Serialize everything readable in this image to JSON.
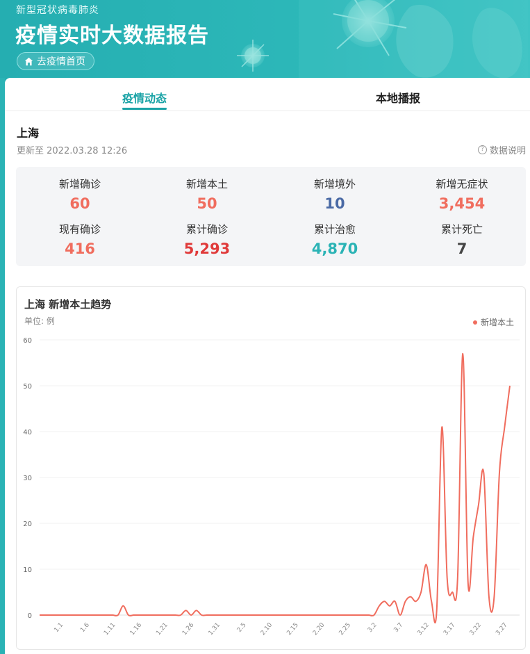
{
  "header": {
    "sub_title": "新型冠状病毒肺炎",
    "title": "疫情实时大数据报告",
    "home_button": "去疫情首页"
  },
  "tabs": [
    {
      "label": "疫情动态",
      "active": true
    },
    {
      "label": "本地播报",
      "active": false
    }
  ],
  "region": "上海",
  "update_time": "更新至 2022.03.28 12:26",
  "data_note": "数据说明",
  "stats": [
    {
      "label": "新增确诊",
      "value": "60",
      "color": "#f06d5e"
    },
    {
      "label": "新增本土",
      "value": "50",
      "color": "#f06d5e"
    },
    {
      "label": "新增境外",
      "value": "10",
      "color": "#4a6aa5"
    },
    {
      "label": "新增无症状",
      "value": "3,454",
      "color": "#f06d5e"
    },
    {
      "label": "现有确诊",
      "value": "416",
      "color": "#f06d5e"
    },
    {
      "label": "累计确诊",
      "value": "5,293",
      "color": "#e03a3a"
    },
    {
      "label": "累计治愈",
      "value": "4,870",
      "color": "#2ab3b5"
    },
    {
      "label": "累计死亡",
      "value": "7",
      "color": "#444444"
    }
  ],
  "chart_data": {
    "type": "line",
    "title": "上海 新增本土趋势",
    "unit_label": "单位: 例",
    "legend": "新增本土",
    "legend_position": "top-right",
    "color": "#f06d5e",
    "grid": true,
    "ylim": [
      0,
      60
    ],
    "y_ticks": [
      0,
      10,
      20,
      30,
      40,
      50,
      60
    ],
    "x_ticks": [
      "1.1",
      "1.6",
      "1.11",
      "1.16",
      "1.21",
      "1.26",
      "1.31",
      "2.5",
      "2.10",
      "2.15",
      "2.20",
      "2.25",
      "3.2",
      "3.7",
      "3.12",
      "3.17",
      "3.22",
      "3.27"
    ],
    "x": [
      "12.28",
      "12.29",
      "12.30",
      "12.31",
      "1.1",
      "1.2",
      "1.3",
      "1.4",
      "1.5",
      "1.6",
      "1.7",
      "1.8",
      "1.9",
      "1.10",
      "1.11",
      "1.12",
      "1.13",
      "1.14",
      "1.15",
      "1.16",
      "1.17",
      "1.18",
      "1.19",
      "1.20",
      "1.21",
      "1.22",
      "1.23",
      "1.24",
      "1.25",
      "1.26",
      "1.27",
      "1.28",
      "1.29",
      "1.30",
      "1.31",
      "2.1",
      "2.2",
      "2.3",
      "2.4",
      "2.5",
      "2.6",
      "2.7",
      "2.8",
      "2.9",
      "2.10",
      "2.11",
      "2.12",
      "2.13",
      "2.14",
      "2.15",
      "2.16",
      "2.17",
      "2.18",
      "2.19",
      "2.20",
      "2.21",
      "2.22",
      "2.23",
      "2.24",
      "2.25",
      "2.26",
      "2.27",
      "2.28",
      "3.1",
      "3.2",
      "3.3",
      "3.4",
      "3.5",
      "3.6",
      "3.7",
      "3.8",
      "3.9",
      "3.10",
      "3.11",
      "3.12",
      "3.13",
      "3.14",
      "3.15",
      "3.16",
      "3.17",
      "3.18",
      "3.19",
      "3.20",
      "3.21",
      "3.22",
      "3.23",
      "3.24",
      "3.25",
      "3.26",
      "3.27"
    ],
    "values": [
      0,
      0,
      0,
      0,
      0,
      0,
      0,
      0,
      0,
      0,
      0,
      0,
      0,
      0,
      0,
      0,
      2,
      0,
      0,
      0,
      0,
      0,
      0,
      0,
      0,
      0,
      0,
      0,
      1,
      0,
      1,
      0,
      0,
      0,
      0,
      0,
      0,
      0,
      0,
      0,
      0,
      0,
      0,
      0,
      0,
      0,
      0,
      0,
      0,
      0,
      0,
      0,
      0,
      0,
      0,
      0,
      0,
      0,
      0,
      0,
      0,
      0,
      0,
      0,
      0,
      2,
      3,
      2,
      3,
      0,
      3,
      4,
      3,
      5,
      11,
      3,
      1,
      41,
      8,
      5,
      8,
      57,
      7,
      17,
      24,
      31,
      4,
      4,
      31,
      41,
      50
    ]
  }
}
